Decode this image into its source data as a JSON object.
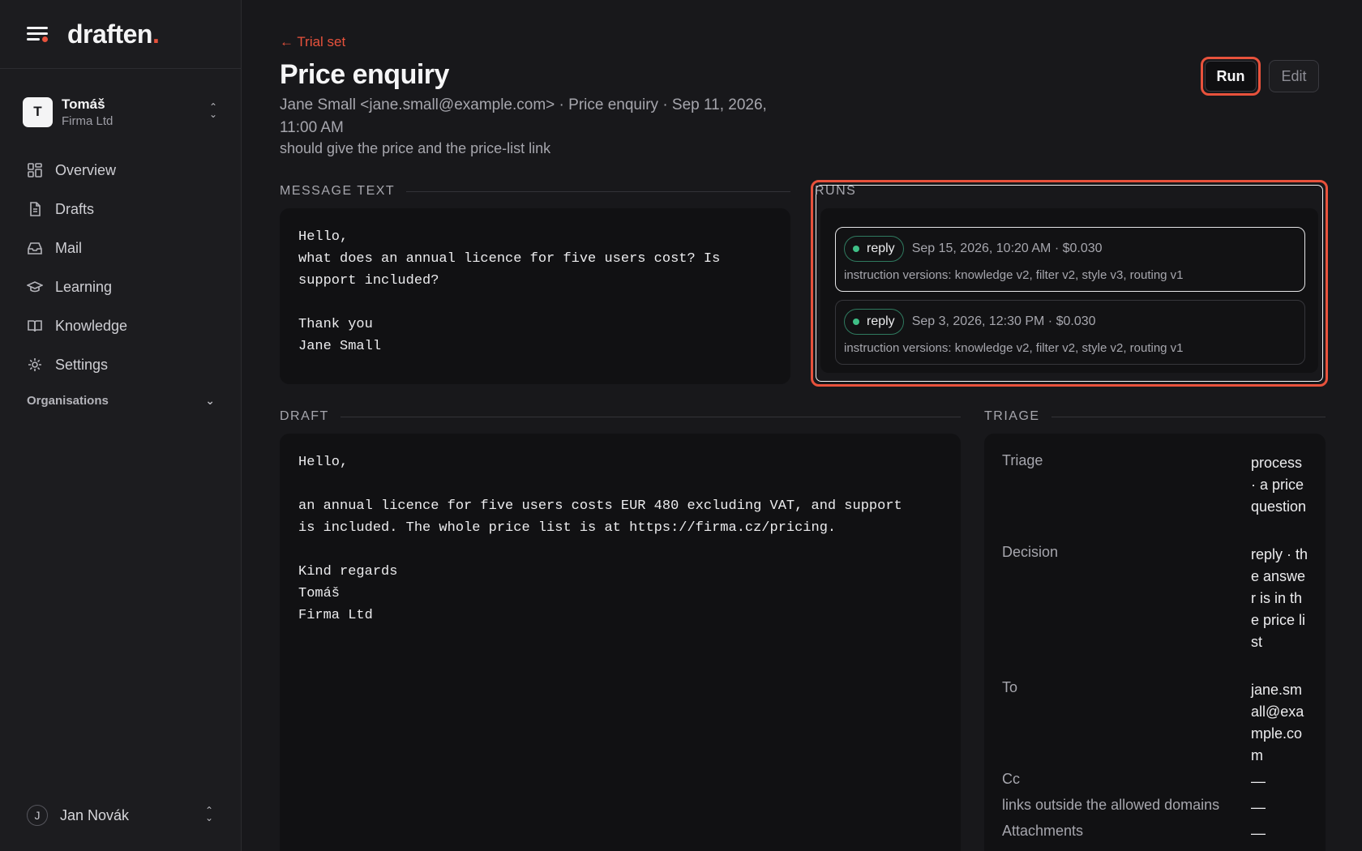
{
  "brand": {
    "name": "draften",
    "dot": "."
  },
  "org": {
    "initial": "T",
    "name": "Tomáš",
    "company": "Firma Ltd"
  },
  "nav": {
    "items": [
      {
        "label": "Overview",
        "icon": "grid-icon"
      },
      {
        "label": "Drafts",
        "icon": "document-icon"
      },
      {
        "label": "Mail",
        "icon": "inbox-icon"
      },
      {
        "label": "Learning",
        "icon": "graduation-cap-icon"
      },
      {
        "label": "Knowledge",
        "icon": "book-icon"
      },
      {
        "label": "Settings",
        "icon": "gear-icon"
      }
    ],
    "organisations_label": "Organisations"
  },
  "user": {
    "initial": "J",
    "name": "Jan Novák"
  },
  "header": {
    "back_label": "← Trial set",
    "title": "Price enquiry",
    "meta": "Jane Small <jane.small@example.com> · Price enquiry · Sep 11, 2026, 11:00 AM",
    "note": "should give the price and the price-list link",
    "run_label": "Run",
    "edit_label": "Edit"
  },
  "message": {
    "label": "MESSAGE TEXT",
    "text": "Hello,\nwhat does an annual licence for five users cost? Is\nsupport included?\n\nThank you\nJane Small"
  },
  "runs": {
    "label": "RUNS",
    "items": [
      {
        "status": "reply",
        "meta": "Sep 15, 2026, 10:20 AM · $0.030",
        "versions": "instruction versions: knowledge v2, filter v2, style v3, routing v1"
      },
      {
        "status": "reply",
        "meta": "Sep 3, 2026, 12:30 PM · $0.030",
        "versions": "instruction versions: knowledge v2, filter v2, style v2, routing v1"
      }
    ]
  },
  "draft": {
    "label": "DRAFT",
    "text": "Hello,\n\nan annual licence for five users costs EUR 480 excluding VAT, and support\nis included. The whole price list is at https://firma.cz/pricing.\n\nKind regards\nTomáš\nFirma Ltd"
  },
  "triage": {
    "label": "TRIAGE",
    "rows": [
      {
        "key": "Triage",
        "value": "process · a price question"
      },
      {
        "key": "Decision",
        "value": "reply · the answer is in the price list"
      },
      {
        "key": "To",
        "value": "jane.small@example.com"
      },
      {
        "key": "Cc",
        "value": "—"
      },
      {
        "key": "links outside the allowed domains",
        "value": "—"
      },
      {
        "key": "Attachments",
        "value": "—"
      }
    ]
  },
  "colors": {
    "accent": "#e8523c",
    "success": "#3fbf87",
    "background": "#18181b"
  }
}
